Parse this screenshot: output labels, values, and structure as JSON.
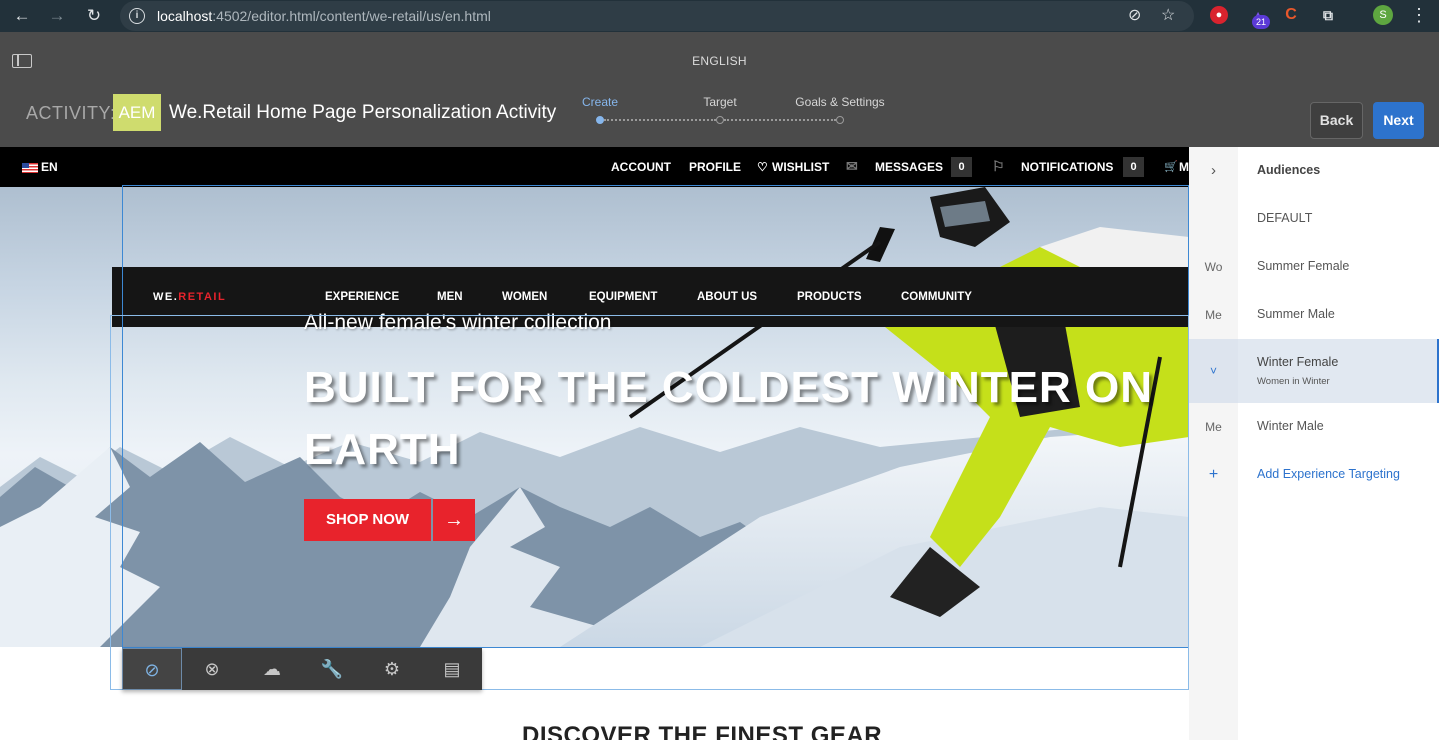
{
  "browser": {
    "url_host": "localhost",
    "url_path": ":4502/editor.html/content/we-retail/us/en.html",
    "extension_badge": "21",
    "profile_initial": "S",
    "extension_c": "C"
  },
  "header": {
    "page_language": "ENGLISH",
    "activity_label": "ACTIVITY:",
    "brand": "AEM",
    "activity_title": "We.Retail Home Page Personalization Activity",
    "steps": [
      {
        "label": "Create",
        "active": true
      },
      {
        "label": "Target",
        "active": false
      },
      {
        "label": "Goals & Settings",
        "active": false
      }
    ],
    "back_label": "Back",
    "next_label": "Next"
  },
  "site": {
    "lang_code": "EN",
    "topbar": {
      "account": "ACCOUNT",
      "profile": "PROFILE",
      "wishlist": "WISHLIST",
      "messages": "MESSAGES",
      "messages_count": "0",
      "notifications": "NOTIFICATIONS",
      "notifications_count": "0",
      "cart_truncated": "M"
    },
    "logo_we": "WE.",
    "logo_retail": "RETAIL",
    "nav": [
      "EXPERIENCE",
      "MEN",
      "WOMEN",
      "EQUIPMENT",
      "ABOUT US",
      "PRODUCTS",
      "COMMUNITY"
    ],
    "hero_subtitle": "All-new female's winter collection",
    "hero_title": "BUILT FOR THE COLDEST WINTER ON EARTH",
    "shop_now": "SHOP NOW",
    "section_heading": "DISCOVER THE FINEST GEAR"
  },
  "audiences_panel": {
    "heading": "Audiences",
    "rows": [
      {
        "abbr": "",
        "label": "DEFAULT",
        "sub": ""
      },
      {
        "abbr": "Wo",
        "label": "Summer Female",
        "sub": ""
      },
      {
        "abbr": "Me",
        "label": "Summer Male",
        "sub": ""
      },
      {
        "abbr": "˅",
        "label": "Winter Female",
        "sub": "Women in Winter",
        "selected": true
      },
      {
        "abbr": "Me",
        "label": "Winter Male",
        "sub": ""
      }
    ],
    "add_label": "Add Experience Targeting"
  },
  "colors": {
    "accent_blue": "#2d73cd",
    "brand_red": "#e8232c",
    "aem_badge": "#cfdc6e",
    "header_bg": "#4b4b4b"
  }
}
